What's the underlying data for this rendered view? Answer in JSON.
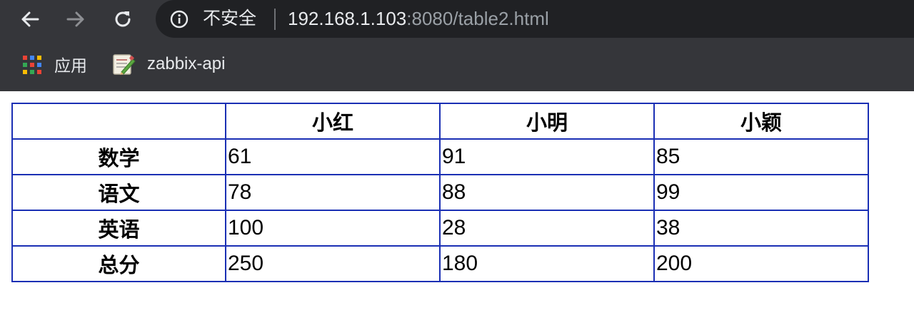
{
  "browser": {
    "security_label": "不安全",
    "url_host": "192.168.1.103",
    "url_rest": ":8080/table2.html",
    "bookmarks": [
      {
        "label": "应用",
        "icon": "apps-grid-icon"
      },
      {
        "label": "zabbix-api",
        "icon": "notepad-favicon-icon"
      }
    ],
    "colors": {
      "frame": "#35363a",
      "omnibox": "#202124",
      "text": "#e8eaed",
      "url_dim": "#9aa0a6"
    }
  },
  "table": {
    "border_color": "#1a2fb4",
    "headers": [
      "",
      "小红",
      "小明",
      "小颖"
    ],
    "rows": [
      {
        "subject": "数学",
        "values": [
          "61",
          "91",
          "85"
        ]
      },
      {
        "subject": "语文",
        "values": [
          "78",
          "88",
          "99"
        ]
      },
      {
        "subject": "英语",
        "values": [
          "100",
          "28",
          "38"
        ]
      },
      {
        "subject": "总分",
        "values": [
          "250",
          "180",
          "200"
        ]
      }
    ]
  }
}
